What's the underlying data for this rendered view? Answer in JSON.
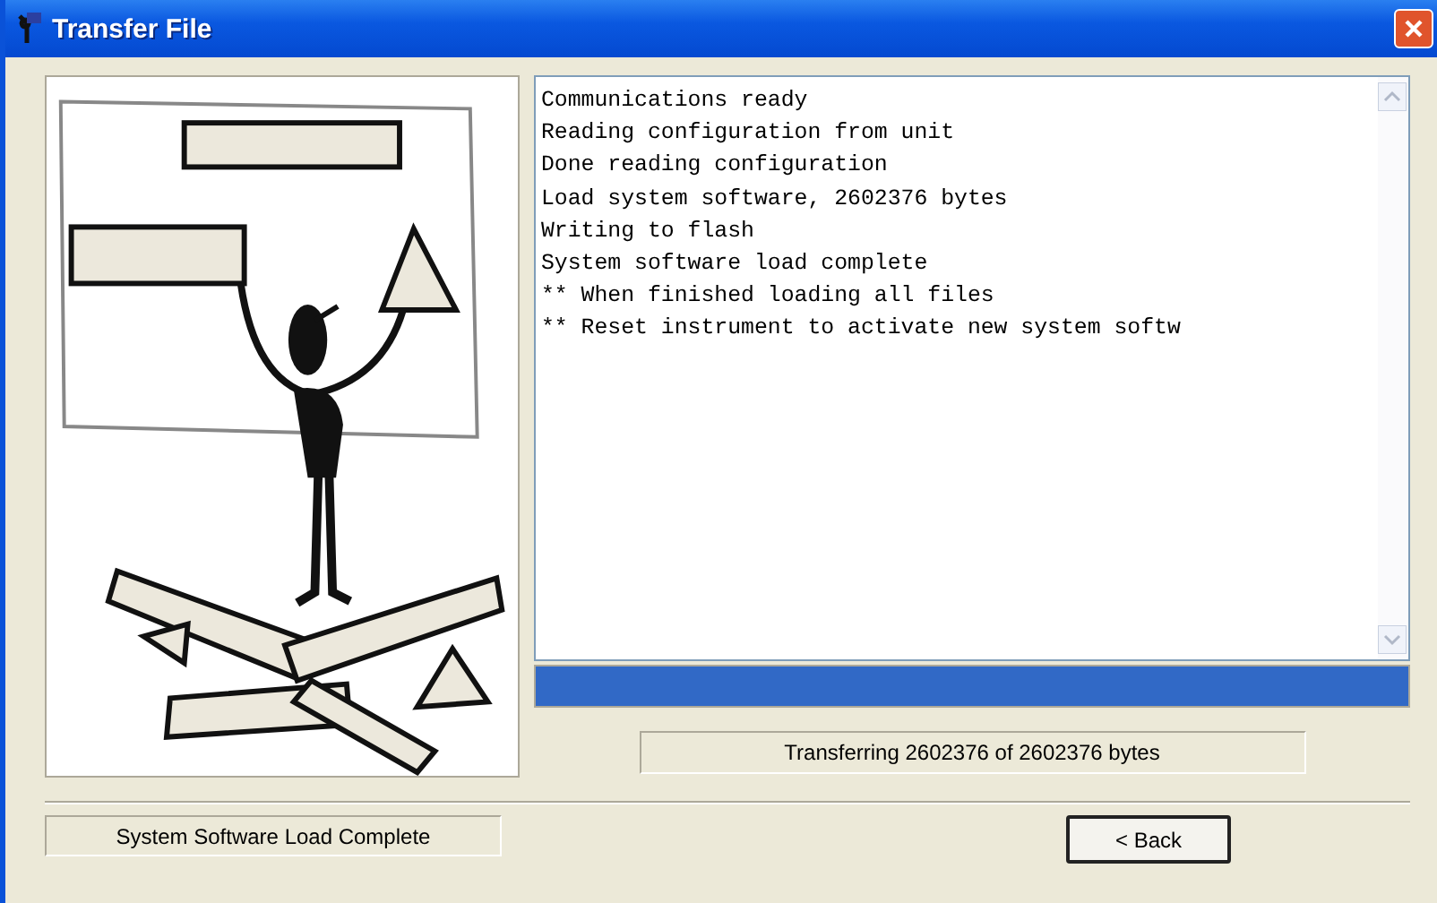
{
  "window": {
    "title": "Transfer File"
  },
  "log": {
    "lines": [
      "Communications ready",
      "Reading configuration from unit",
      "Done reading configuration",
      "Load system software, 2602376 bytes",
      "Writing to flash",
      "System software load complete",
      "** When finished loading all files",
      "** Reset instrument to activate new system softw"
    ]
  },
  "progress": {
    "level": 1
  },
  "transfer_status": "Transferring 2602376 of 2602376 bytes",
  "status_text": "System Software Load Complete",
  "buttons": [
    {
      "label": "< Back"
    }
  ]
}
